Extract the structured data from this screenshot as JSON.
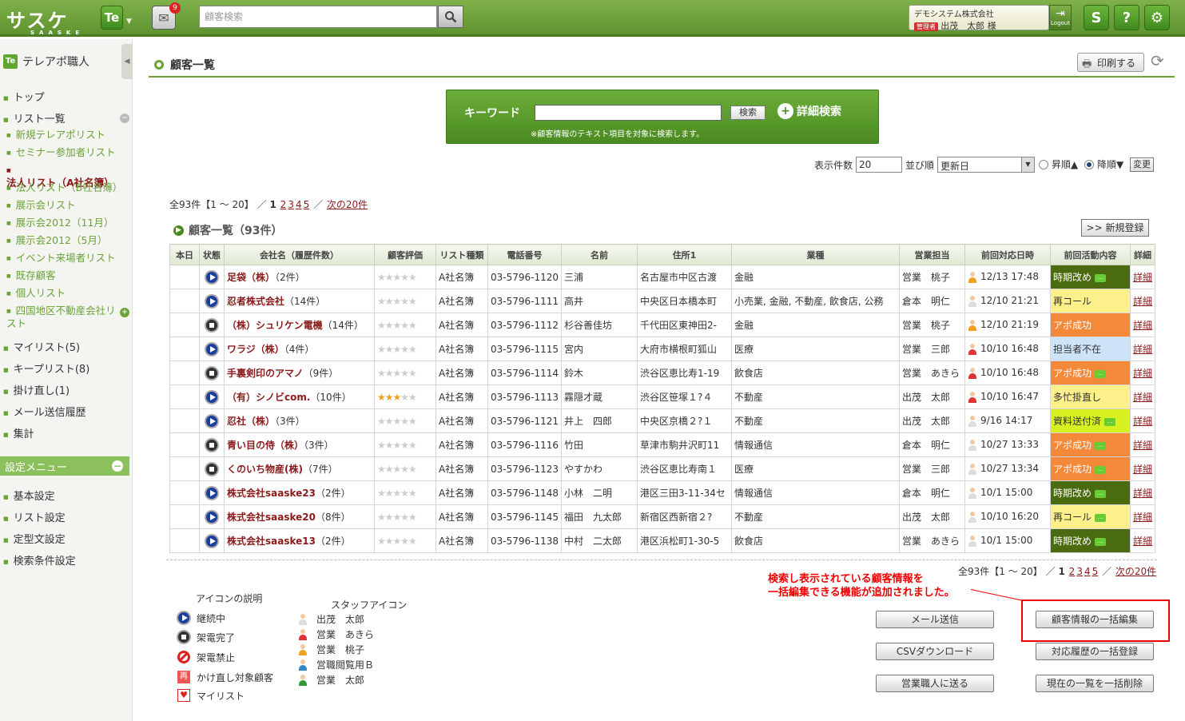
{
  "header": {
    "logo_text": "サスケ",
    "logo_sub": "SAASKE",
    "app_button": "Te",
    "message_count": "9",
    "search_placeholder": "顧客検索",
    "company": "デモシステム株式会社",
    "role": "管理者",
    "user_name": "出茂　太郎 様",
    "logout": "Logout",
    "icons": [
      "saaske-icon",
      "help-icon",
      "gear-icon"
    ]
  },
  "sidebar": {
    "app_title": "テレアポ職人",
    "app_badge": "Te",
    "items": [
      {
        "label": "トップ"
      },
      {
        "label": "リスト一覧"
      },
      {
        "label": "マイリスト(5)"
      },
      {
        "label": "キープリスト(8)"
      },
      {
        "label": "掛け直し(1)"
      },
      {
        "label": "メール送信履歴"
      },
      {
        "label": "集計"
      }
    ],
    "lists": [
      "新規テレアポリスト",
      "セミナー参加者リスト",
      "法人リスト（A社名簿）",
      "法人リスト（B社名簿）",
      "展示会リスト",
      "展示会2012（11月）",
      "展示会2012（5月）",
      "イベント来場者リスト",
      "既存顧客",
      "個人リスト",
      "四国地区不動産会社リスト"
    ],
    "settings_title": "設定メニュー",
    "settings": [
      "基本設定",
      "リスト設定",
      "定型文設定",
      "検索条件設定"
    ]
  },
  "main": {
    "page_title": "顧客一覧",
    "print_label": "印刷する",
    "keyword": {
      "label": "キーワード",
      "search_button": "検索",
      "advanced": "詳細検索",
      "note": "※顧客情報のテキスト項目を対象に検索します。"
    },
    "controls": {
      "display_count_label": "表示件数",
      "display_count": "20",
      "sort_label": "並び順",
      "sort_value": "更新日",
      "asc": "昇順▲",
      "desc": "降順▼",
      "change": "変更"
    },
    "pager": {
      "summary": "全93件【1 ～ 20】",
      "sep": "／",
      "current": "1",
      "pages": [
        "2",
        "3",
        "4",
        "5"
      ],
      "sep2": "／",
      "next": "次の20件"
    },
    "list_title": "顧客一覧（93件）",
    "new_button": ">> 新規登録",
    "columns": [
      "本日",
      "状態",
      "会社名（履歴件数）",
      "顧客評価",
      "リスト種類",
      "電話番号",
      "名前",
      "住所1",
      "業種",
      "営業担当",
      "前回対応日時",
      "前回活動内容",
      "詳細"
    ],
    "rows": [
      {
        "status": "cont",
        "company": "足袋（株）",
        "count": "（2件）",
        "stars": 0,
        "list": "A社名簿",
        "phone": "03-5796-1120",
        "name": "三浦",
        "address": "名古屋市中区古渡",
        "industry": "金融",
        "rep": "営業　桃子",
        "staff": "s3",
        "date": "12/13 17:48",
        "activity": "時期改め",
        "act_color": "#4b6b10",
        "act_text": "#fff",
        "memo": true,
        "detail": "詳細"
      },
      {
        "status": "cont",
        "company": "忍者株式会社",
        "count": "（14件）",
        "stars": 0,
        "list": "A社名簿",
        "phone": "03-5796-1111",
        "name": "高井",
        "address": "中央区日本橋本町",
        "industry": "小売業, 金融, 不動産, 飲食店, 公務",
        "rep": "倉本　明仁",
        "staff": "s1",
        "date": "12/10 21:21",
        "activity": "再コール",
        "act_color": "#fbf08a",
        "act_text": "#333",
        "memo": false,
        "detail": "詳細"
      },
      {
        "status": "done",
        "company": "（株）シュリケン電機",
        "count": "（14件）",
        "stars": 0,
        "list": "A社名簿",
        "phone": "03-5796-1112",
        "name": "杉谷善佳坊",
        "address": "千代田区東神田2-",
        "industry": "金融",
        "rep": "営業　桃子",
        "staff": "s3",
        "date": "12/10 21:19",
        "activity": "アポ成功",
        "act_color": "#f5893a",
        "act_text": "#fff",
        "memo": false,
        "detail": "詳細"
      },
      {
        "status": "cont",
        "company": "ワラジ（株）",
        "count": "（4件）",
        "stars": 0,
        "list": "A社名簿",
        "phone": "03-5796-1115",
        "name": "宮内",
        "address": "大府市横根町狐山",
        "industry": "医療",
        "rep": "営業　三郎",
        "staff": "s2",
        "date": "10/10 16:48",
        "activity": "担当者不在",
        "act_color": "#cde4f8",
        "act_text": "#333",
        "memo": false,
        "detail": "詳細"
      },
      {
        "status": "done",
        "company": "手裏剣印のアマノ",
        "count": "（9件）",
        "stars": 0,
        "list": "A社名簿",
        "phone": "03-5796-1114",
        "name": "鈴木",
        "address": "渋谷区恵比寿1-19",
        "industry": "飲食店",
        "rep": "営業　あきら",
        "staff": "s2",
        "date": "10/10 16:48",
        "activity": "アポ成功",
        "act_color": "#f5893a",
        "act_text": "#fff",
        "memo": true,
        "detail": "詳細"
      },
      {
        "status": "cont",
        "company": "（有）シノビcom.",
        "count": "（10件）",
        "stars": 3,
        "list": "A社名簿",
        "phone": "03-5796-1113",
        "name": "霧隠才蔵",
        "address": "渋谷区笹塚１?４",
        "industry": "不動産",
        "rep": "出茂　太郎",
        "staff": "s2",
        "date": "10/10 16:47",
        "activity": "多忙掛直し",
        "act_color": "#fbf08a",
        "act_text": "#333",
        "memo": false,
        "detail": "詳細"
      },
      {
        "status": "cont",
        "company": "忍社（株）",
        "count": "（3件）",
        "stars": 0,
        "list": "A社名簿",
        "phone": "03-5796-1121",
        "name": "井上　四郎",
        "address": "中央区京橋２?１",
        "industry": "不動産",
        "rep": "出茂　太郎",
        "staff": "s1",
        "date": "9/16 14:17",
        "activity": "資料送付済",
        "act_color": "#d6f020",
        "act_text": "#333",
        "memo": true,
        "detail": "詳細"
      },
      {
        "status": "done",
        "company": "青い目の侍（株）",
        "count": "（3件）",
        "stars": 0,
        "list": "A社名簿",
        "phone": "03-5796-1116",
        "name": "竹田",
        "address": "草津市駒井沢町11",
        "industry": "情報通信",
        "rep": "倉本　明仁",
        "staff": "s1",
        "date": "10/27 13:33",
        "activity": "アポ成功",
        "act_color": "#f5893a",
        "act_text": "#fff",
        "memo": true,
        "detail": "詳細"
      },
      {
        "status": "done",
        "company": "くのいち物産(株)",
        "count": "（7件）",
        "stars": 0,
        "list": "A社名簿",
        "phone": "03-5796-1123",
        "name": "やすかわ",
        "address": "渋谷区恵比寿南１",
        "industry": "医療",
        "rep": "営業　三郎",
        "staff": "s1",
        "date": "10/27 13:34",
        "activity": "アポ成功",
        "act_color": "#f5893a",
        "act_text": "#fff",
        "memo": true,
        "detail": "詳細"
      },
      {
        "status": "cont",
        "company": "株式会社saaske23",
        "count": "（2件）",
        "stars": 0,
        "list": "A社名簿",
        "phone": "03-5796-1148",
        "name": "小林　二明",
        "address": "港区三田3-11-34セ",
        "industry": "情報通信",
        "rep": "倉本　明仁",
        "staff": "s1",
        "date": "10/1 15:00",
        "activity": "時期改め",
        "act_color": "#4b6b10",
        "act_text": "#fff",
        "memo": true,
        "detail": "詳細"
      },
      {
        "status": "cont",
        "company": "株式会社saaske20",
        "count": "（8件）",
        "stars": 0,
        "list": "A社名簿",
        "phone": "03-5796-1145",
        "name": "福田　九太郎",
        "address": "新宿区西新宿２?",
        "industry": "不動産",
        "rep": "出茂　太郎",
        "staff": "s1",
        "date": "10/10 16:20",
        "activity": "再コール",
        "act_color": "#fbf08a",
        "act_text": "#333",
        "memo": true,
        "detail": "詳細"
      },
      {
        "status": "cont",
        "company": "株式会社saaske13",
        "count": "（2件）",
        "stars": 0,
        "list": "A社名簿",
        "phone": "03-5796-1138",
        "name": "中村　二太郎",
        "address": "港区浜松町1-30-5",
        "industry": "飲食店",
        "rep": "営業　あきら",
        "staff": "s1",
        "date": "10/1 15:00",
        "activity": "時期改め",
        "act_color": "#4b6b10",
        "act_text": "#fff",
        "memo": true,
        "detail": "詳細"
      }
    ],
    "legend": {
      "title": "アイコンの説明",
      "items": [
        "継続中",
        "架電完了",
        "架電禁止",
        "かけ直し対象顧客",
        "マイリスト"
      ],
      "re_glyph": "再",
      "staff_title": "スタッフアイコン",
      "staff": [
        "出茂　太郎",
        "営業　あきら",
        "営業　桃子",
        "営職閲覧用Ｂ",
        "営業　太郎"
      ]
    },
    "annotation": {
      "line1": "検索し表示されている顧客情報を",
      "line2": "一括編集できる機能が追加されました。"
    },
    "actions": {
      "mail": "メール送信",
      "csv": "CSVダウンロード",
      "send": "営業職人に送る",
      "bulk_edit": "顧客情報の一括編集",
      "bulk_history": "対応履歴の一括登録",
      "bulk_delete": "現在の一覧を一括削除"
    }
  }
}
